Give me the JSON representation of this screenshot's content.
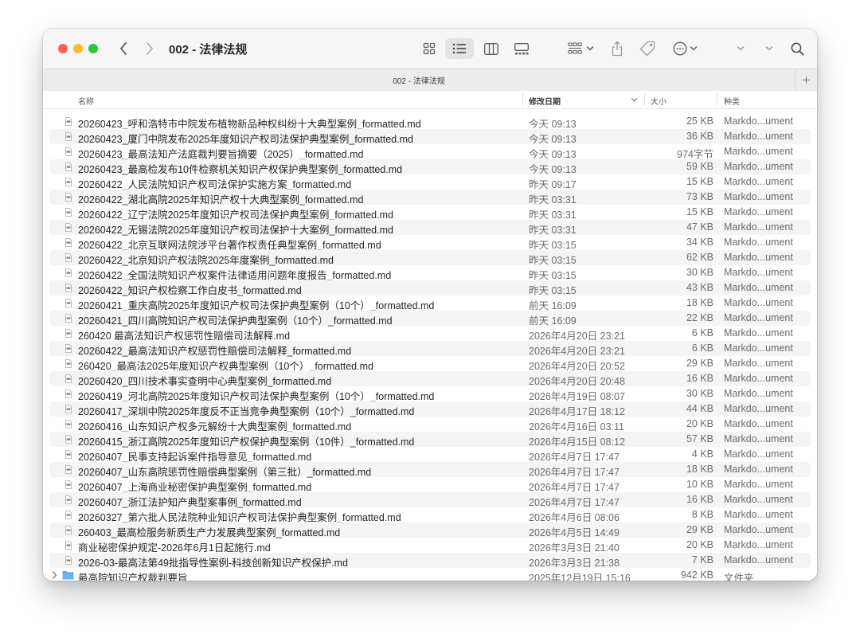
{
  "window": {
    "title": "002 - 法律法规"
  },
  "tab": {
    "title": "002 - 法律法规",
    "add_label": "+"
  },
  "columns": {
    "name": "名称",
    "date": "修改日期",
    "size": "大小",
    "kind": "种类"
  },
  "colors": {
    "close": "#ff5f57",
    "minimize": "#febc2e",
    "maximize": "#28c840",
    "folder": "#5aa7ea"
  },
  "files": [
    {
      "name": "20260423_呼和浩特市中院发布植物新品种权纠纷十大典型案例_formatted.md",
      "date": "今天 09:13",
      "size": "25 KB",
      "kind": "Markdo...ument"
    },
    {
      "name": "20260423_厦门中院发布2025年度知识产权司法保护典型案例_formatted.md",
      "date": "今天 09:13",
      "size": "36 KB",
      "kind": "Markdo...ument"
    },
    {
      "name": "20260423_最高法知产法庭裁判要旨摘要（2025）_formatted.md",
      "date": "今天 09:13",
      "size": "974字节",
      "kind": "Markdo...ument"
    },
    {
      "name": "20260423_最高检发布10件检察机关知识产权保护典型案例_formatted.md",
      "date": "今天 09:13",
      "size": "59 KB",
      "kind": "Markdo...ument"
    },
    {
      "name": "20260422_人民法院知识产权司法保护实施方案_formatted.md",
      "date": "昨天 09:17",
      "size": "15 KB",
      "kind": "Markdo...ument"
    },
    {
      "name": "20260422_湖北高院2025年知识产权十大典型案例_formatted.md",
      "date": "昨天 03:31",
      "size": "73 KB",
      "kind": "Markdo...ument"
    },
    {
      "name": "20260422_辽宁法院2025年度知识产权司法保护典型案例_formatted.md",
      "date": "昨天 03:31",
      "size": "15 KB",
      "kind": "Markdo...ument"
    },
    {
      "name": "20260422_无锡法院2025年度知识产权司法保护十大案例_formatted.md",
      "date": "昨天 03:31",
      "size": "47 KB",
      "kind": "Markdo...ument"
    },
    {
      "name": "20260422_北京互联网法院涉平台著作权责任典型案例_formatted.md",
      "date": "昨天 03:15",
      "size": "34 KB",
      "kind": "Markdo...ument"
    },
    {
      "name": "20260422_北京知识产权法院2025年度案例_formatted.md",
      "date": "昨天 03:15",
      "size": "62 KB",
      "kind": "Markdo...ument"
    },
    {
      "name": "20260422_全国法院知识产权案件法律适用问题年度报告_formatted.md",
      "date": "昨天 03:15",
      "size": "30 KB",
      "kind": "Markdo...ument"
    },
    {
      "name": "20260422_知识产权检察工作白皮书_formatted.md",
      "date": "昨天 03:15",
      "size": "43 KB",
      "kind": "Markdo...ument"
    },
    {
      "name": "20260421_重庆高院2025年度知识产权司法保护典型案例（10个）_formatted.md",
      "date": "前天 16:09",
      "size": "18 KB",
      "kind": "Markdo...ument"
    },
    {
      "name": "20260421_四川高院知识产权司法保护典型案例（10个）_formatted.md",
      "date": "前天 16:09",
      "size": "22 KB",
      "kind": "Markdo...ument"
    },
    {
      "name": "260420 最高法知识产权惩罚性赔偿司法解释.md",
      "date": "2026年4月20日 23:21",
      "size": "6 KB",
      "kind": "Markdo...ument"
    },
    {
      "name": "20260422_最高法知识产权惩罚性赔偿司法解释_formatted.md",
      "date": "2026年4月20日 23:21",
      "size": "6 KB",
      "kind": "Markdo...ument"
    },
    {
      "name": "260420_最高法2025年度知识产权典型案例（10个）_formatted.md",
      "date": "2026年4月20日 20:52",
      "size": "29 KB",
      "kind": "Markdo...ument"
    },
    {
      "name": "20260420_四川技术事实查明中心典型案例_formatted.md",
      "date": "2026年4月20日 20:48",
      "size": "16 KB",
      "kind": "Markdo...ument"
    },
    {
      "name": "20260419_河北高院2025年度知识产权司法保护典型案例（10个）_formatted.md",
      "date": "2026年4月19日 08:07",
      "size": "30 KB",
      "kind": "Markdo...ument"
    },
    {
      "name": "20260417_深圳中院2025年度反不正当竞争典型案例（10个）_formatted.md",
      "date": "2026年4月17日 18:12",
      "size": "44 KB",
      "kind": "Markdo...ument"
    },
    {
      "name": "20260416_山东知识产权多元解纷十大典型案例_formatted.md",
      "date": "2026年4月16日 03:11",
      "size": "20 KB",
      "kind": "Markdo...ument"
    },
    {
      "name": "20260415_浙江高院2025年度知识产权保护典型案例（10件）_formatted.md",
      "date": "2026年4月15日 08:12",
      "size": "57 KB",
      "kind": "Markdo...ument"
    },
    {
      "name": "20260407_民事支持起诉案件指导意见_formatted.md",
      "date": "2026年4月7日 17:47",
      "size": "4 KB",
      "kind": "Markdo...ument"
    },
    {
      "name": "20260407_山东高院惩罚性赔偿典型案例（第三批）_formatted.md",
      "date": "2026年4月7日 17:47",
      "size": "18 KB",
      "kind": "Markdo...ument"
    },
    {
      "name": "20260407_上海商业秘密保护典型案例_formatted.md",
      "date": "2026年4月7日 17:47",
      "size": "10 KB",
      "kind": "Markdo...ument"
    },
    {
      "name": "20260407_浙江法护知产典型案事例_formatted.md",
      "date": "2026年4月7日 17:47",
      "size": "16 KB",
      "kind": "Markdo...ument"
    },
    {
      "name": "20260327_第六批人民法院种业知识产权司法保护典型案例_formatted.md",
      "date": "2026年4月6日 08:06",
      "size": "8 KB",
      "kind": "Markdo...ument"
    },
    {
      "name": "260403_最高检服务新质生产力发展典型案例_formatted.md",
      "date": "2026年4月5日 14:49",
      "size": "29 KB",
      "kind": "Markdo...ument"
    },
    {
      "name": "商业秘密保护规定-2026年6月1日起施行.md",
      "date": "2026年3月3日 21:40",
      "size": "20 KB",
      "kind": "Markdo...ument"
    },
    {
      "name": "2026-03-最高法第49批指导性案例-科技创新知识产权保护.md",
      "date": "2026年3月3日 21:38",
      "size": "7 KB",
      "kind": "Markdo...ument"
    }
  ],
  "folder_row": {
    "name": "最高院知识产权裁判要旨",
    "date": "2025年12月19日 15:16",
    "size": "942 KB",
    "kind": "文件夹"
  }
}
